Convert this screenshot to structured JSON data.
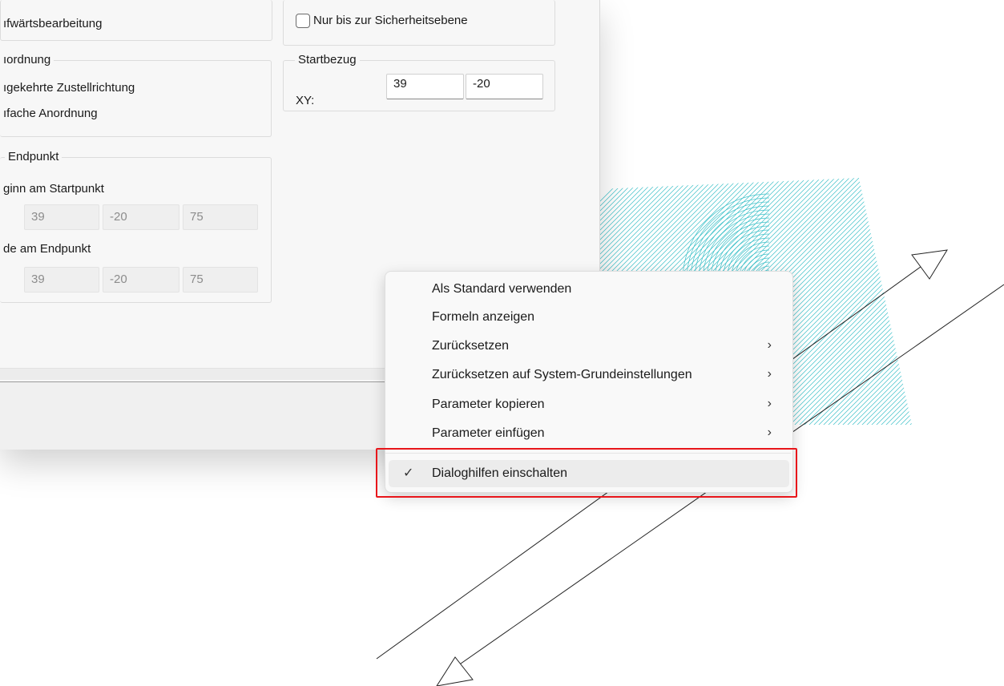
{
  "dialog": {
    "left_group": {
      "row_top_label": "ıfwärtsbearbeitung",
      "anordnung_group_label": "ıordnung",
      "anordnung_items": [
        "ıgekehrte Zustellrichtung",
        "ıfache Anordnung"
      ],
      "endpunkt_group_label": "Endpunkt",
      "start_label": "ginn am Startpunkt",
      "start_values": [
        "39",
        "-20",
        "75"
      ],
      "end_label": "de am Endpunkt",
      "end_values": [
        "39",
        "-20",
        "75"
      ]
    },
    "right_group": {
      "checkbox_label": "Nur bis zur Sicherheitsebene",
      "checkbox_checked": false,
      "startbezug_label": "Startbezug",
      "xy_label": "XY:",
      "x_value": "39",
      "y_value": "-20"
    }
  },
  "context_menu": {
    "items": [
      {
        "label": "Als Standard verwenden",
        "has_submenu": false
      },
      {
        "label": "Formeln anzeigen",
        "has_submenu": false
      },
      {
        "label": "Zurücksetzen",
        "has_submenu": true
      },
      {
        "label": "Zurücksetzen auf System-Grundeinstellungen",
        "has_submenu": true
      },
      {
        "label": "Parameter kopieren",
        "has_submenu": true
      },
      {
        "label": "Parameter einfügen",
        "has_submenu": true
      }
    ],
    "checked_item": {
      "label": "Dialoghilfen einschalten",
      "checked": true,
      "check_glyph": "✓"
    },
    "submenu_glyph": "›"
  },
  "colors": {
    "toolpath": "#3fc1c9",
    "highlight_box": "#e8161b"
  },
  "icons": [
    "checkmark-icon",
    "chevron-right-icon",
    "arrow-head-icon"
  ]
}
